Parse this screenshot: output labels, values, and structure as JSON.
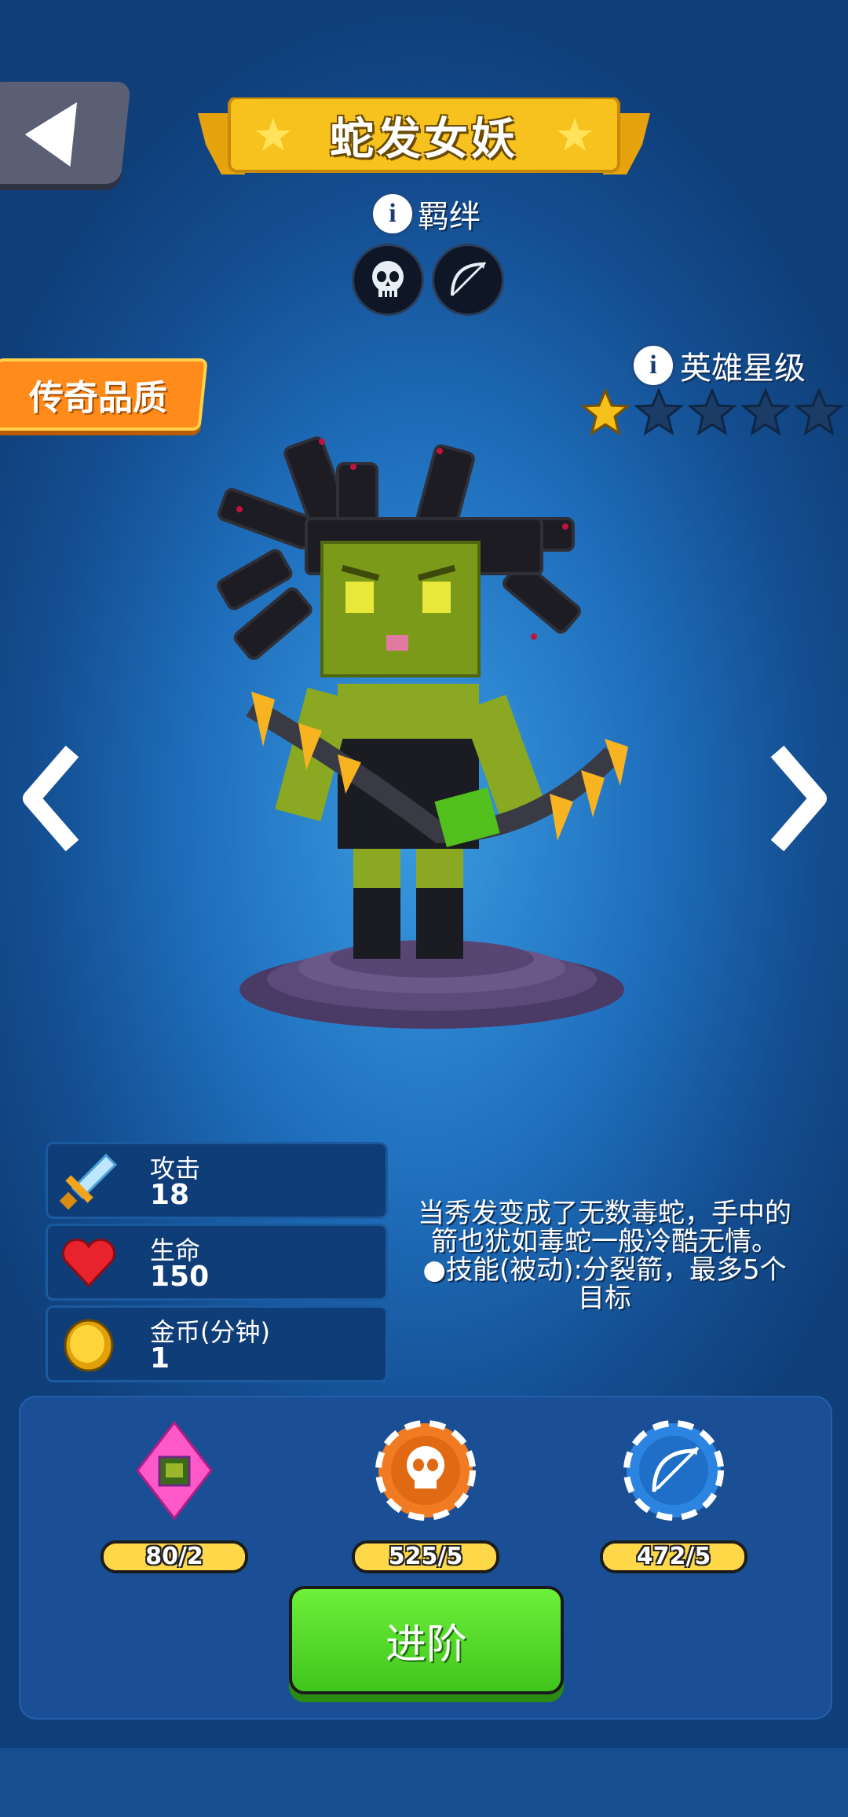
{
  "hero": {
    "name": "蛇发女妖",
    "quality": "传奇品质",
    "star_level_label": "英雄星级",
    "stars_total": 5,
    "stars_filled": 1
  },
  "bond": {
    "label": "羁绊",
    "info_icon": "i",
    "icons": [
      "skull-icon",
      "bow-icon"
    ]
  },
  "stats": {
    "attack": {
      "label": "攻击",
      "value": "18",
      "icon": "sword-icon"
    },
    "health": {
      "label": "生命",
      "value": "150",
      "icon": "heart-icon"
    },
    "gold": {
      "label": "金币(分钟)",
      "value": "1",
      "icon": "coin-icon"
    }
  },
  "description": {
    "lines": [
      "当秀发变成了无数毒蛇，手中的",
      "箭也犹如毒蛇一般冷酷无情。",
      "●技能(被动):分裂箭，最多5个",
      "目标"
    ]
  },
  "resources": [
    {
      "name": "hero-shard",
      "icon": "gem-shard-icon",
      "text": "80/2",
      "fill": 1.0
    },
    {
      "name": "skull-chip",
      "icon": "skull-chip-icon",
      "text": "525/5",
      "fill": 1.0
    },
    {
      "name": "bow-chip",
      "icon": "bow-chip-icon",
      "text": "472/5",
      "fill": 1.0
    }
  ],
  "advance_button": "进阶",
  "colors": {
    "ribbon": "#f7c21e",
    "legendary": "#ff8b1a",
    "star_filled": "#f5c01a",
    "star_empty": "#1a3c66",
    "advance_green": "#4fd526"
  }
}
